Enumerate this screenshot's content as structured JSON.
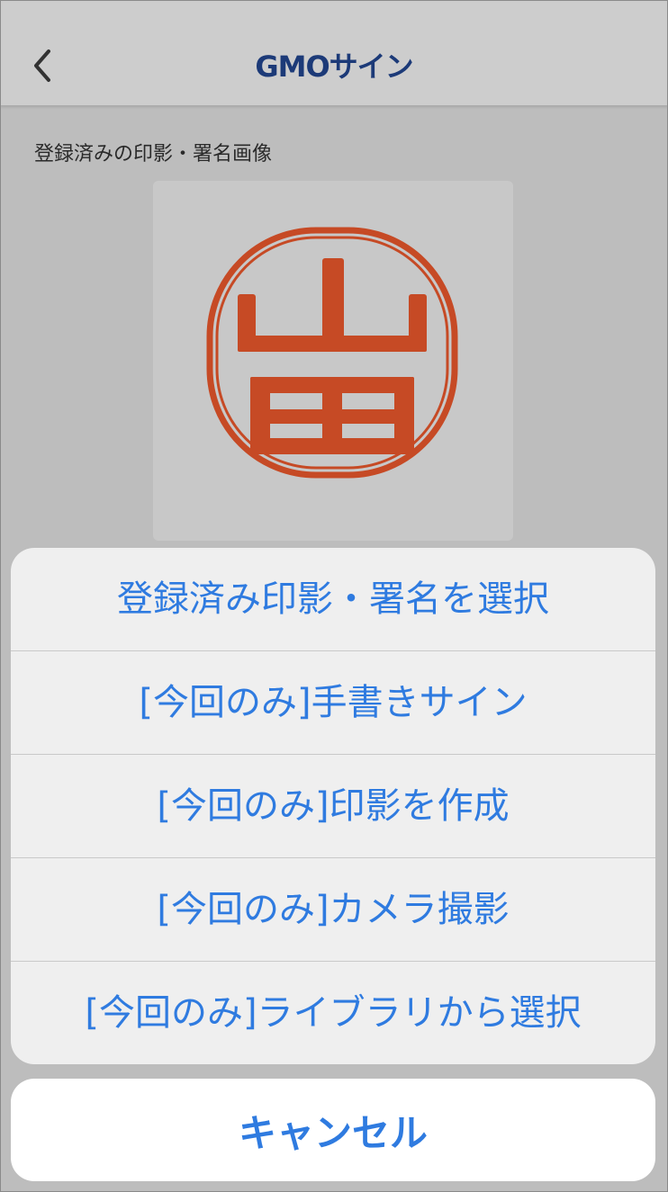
{
  "header": {
    "back_icon": "chevron-left-icon",
    "logo_text": "GMOサイン"
  },
  "content": {
    "section_label": "登録済みの印影・署名画像",
    "stamp_image": {
      "text": "山田",
      "color": "#c64a25"
    }
  },
  "action_sheet": {
    "items": [
      {
        "label": "登録済み印影・署名を選択"
      },
      {
        "label": "[今回のみ]手書きサイン"
      },
      {
        "label": "[今回のみ]印影を作成"
      },
      {
        "label": "[今回のみ]カメラ撮影"
      },
      {
        "label": "[今回のみ]ライブラリから選択"
      }
    ],
    "cancel_label": "キャンセル",
    "accent_color": "#2f7be0"
  }
}
